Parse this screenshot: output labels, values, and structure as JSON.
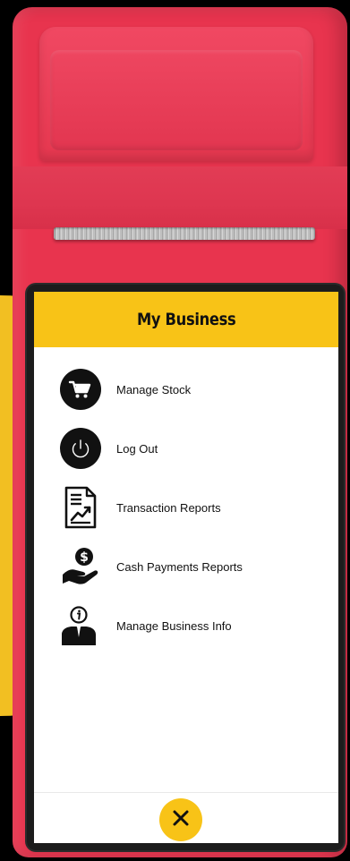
{
  "header": {
    "title": "My Business"
  },
  "menu": {
    "items": [
      {
        "label": "Manage Stock",
        "icon": "cart-icon"
      },
      {
        "label": "Log Out",
        "icon": "power-icon"
      },
      {
        "label": "Transaction Reports",
        "icon": "report-chart-icon"
      },
      {
        "label": "Cash Payments Reports",
        "icon": "hand-dollar-icon"
      },
      {
        "label": "Manage Business Info",
        "icon": "business-info-icon"
      }
    ]
  },
  "footer": {
    "close_icon": "close-icon"
  },
  "colors": {
    "accent": "#F8C317",
    "device": "#E8344E",
    "background": "#000000",
    "text": "#111111"
  }
}
